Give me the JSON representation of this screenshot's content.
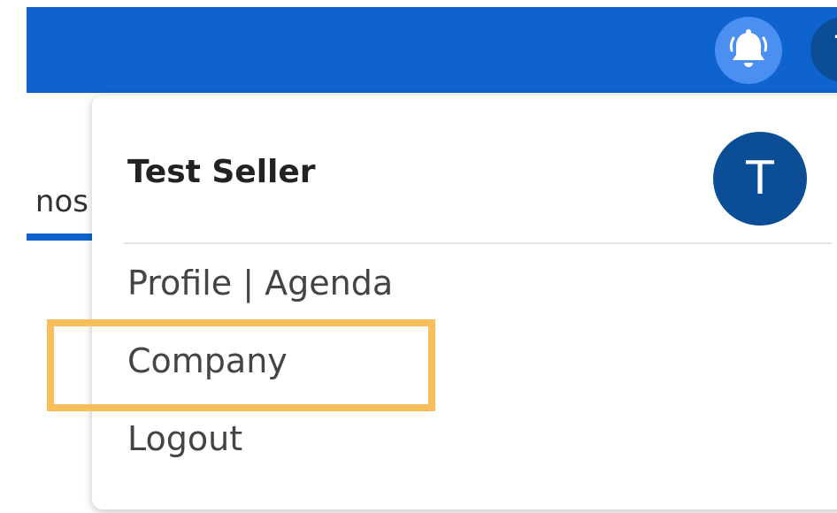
{
  "header": {
    "bell_icon": "bell-icon",
    "avatar_initial": "T"
  },
  "background_tab": {
    "label_fragment": "nos",
    "active": true
  },
  "user_menu": {
    "user_name": "Test Seller",
    "avatar_initial": "T",
    "items": [
      {
        "label": "Profile | Agenda"
      },
      {
        "label": "Company",
        "highlighted": true
      },
      {
        "label": "Logout"
      }
    ]
  },
  "colors": {
    "header_blue": "#0e63cf",
    "bell_circle": "#4b8ff0",
    "avatar_blue": "#0b4e96",
    "highlight": "#f8be5b"
  }
}
